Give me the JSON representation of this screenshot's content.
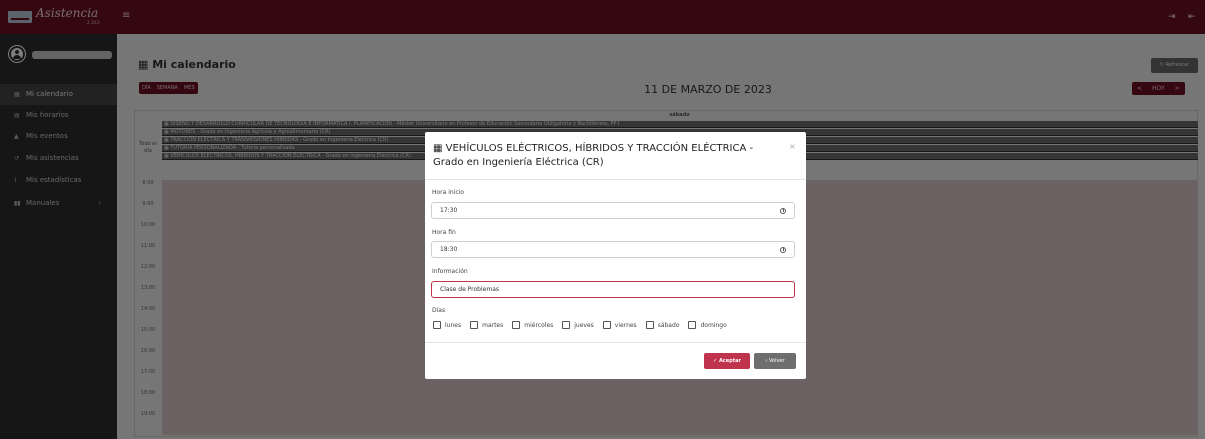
{
  "app": {
    "title": "Asistencia",
    "version": "2.10.0"
  },
  "topbar": {
    "menu_icon": "hamburger-icon",
    "icons": [
      "login-icon",
      "logout-icon"
    ]
  },
  "sidebar": {
    "items": [
      {
        "label": "Mi calendario",
        "icon": "calendar-icon",
        "active": true
      },
      {
        "label": "Mis horarios",
        "icon": "calendar-list-icon",
        "active": false
      },
      {
        "label": "Mis eventos",
        "icon": "bell-icon",
        "active": false
      },
      {
        "label": "Mis asistencias",
        "icon": "history-icon",
        "active": false
      },
      {
        "label": "Mis estadísticas",
        "icon": "chart-icon",
        "active": false
      },
      {
        "label": "Manuales",
        "icon": "book-icon",
        "active": false,
        "has_submenu": true
      }
    ]
  },
  "page": {
    "title": "Mi calendario",
    "refresh_label": "Refrescar",
    "view_buttons": [
      "DÍA",
      "SEMANA",
      "MES"
    ],
    "date_title": "11 DE MARZO DE 2023",
    "nav": {
      "prev": "<",
      "today": "HOY",
      "next": ">"
    }
  },
  "calendar": {
    "day_header": "sábado",
    "allday_label": "Todo el día",
    "events": [
      "DISEÑO Y DESARROLLO CURRICULAR DE TECNOLOGÍA E INFORMÁTICA I. PLANIFICACIÓN - Máster Universitario en Profesor de Educación Secundaria Obligatoria y Bachillerato, FP I",
      "MOTORES - Grado en Ingeniería Agrícola y Agroalimentaria (CR)",
      "TRACCIÓN ELÉCTRICA Y TRANSMISIONES HÍBRIDAS - Grado en Ingeniería Eléctrica (CR)",
      "TUTORÍA PERSONALIZADA - Tutoría personalizada",
      "VEHÍCULOS ELÉCTRICOS, HÍBRIDOS Y TRACCIÓN ELÉCTRICA - Grado en Ingeniería Eléctrica (CR)"
    ],
    "times": [
      "8:00",
      "9:00",
      "10:00",
      "11:00",
      "12:00",
      "13:00",
      "14:00",
      "15:00",
      "16:00",
      "17:00",
      "18:00",
      "19:00"
    ]
  },
  "modal": {
    "title": "VEHÍCULOS ELÉCTRICOS, HÍBRIDOS Y TRACCIÓN ELÉCTRICA - Grado en Ingeniería Eléctrica (CR)",
    "close": "×",
    "start_label": "Hora inicio",
    "start_value": "17:30",
    "end_label": "Hora fin",
    "end_value": "18:30",
    "info_label": "Información",
    "info_value": "Clase de Problemas",
    "days_label": "Días",
    "days": [
      "lunes",
      "martes",
      "miércoles",
      "jueves",
      "viernes",
      "sábado",
      "domingo"
    ],
    "accept_label": "Aceptar",
    "back_label": "Volver"
  }
}
